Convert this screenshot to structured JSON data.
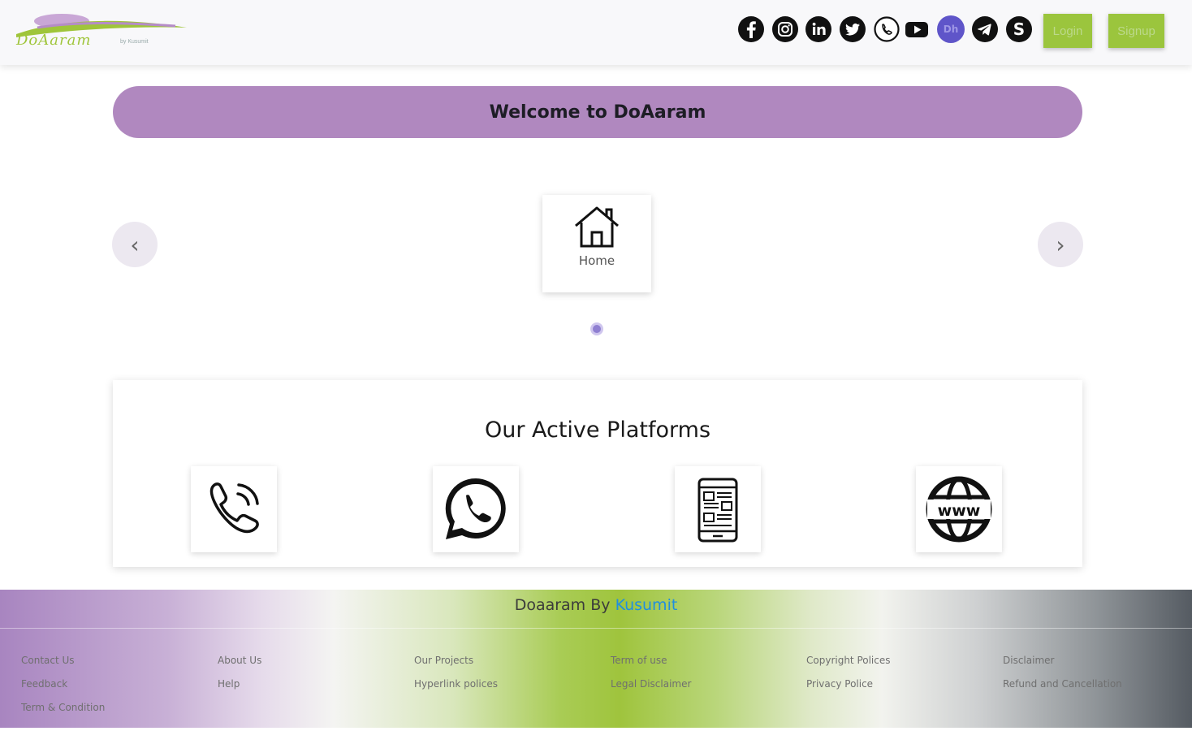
{
  "header": {
    "logo_text": "DoAaram",
    "logo_sub": "by Kusumit",
    "social_icons": [
      "facebook-icon",
      "instagram-icon",
      "linkedin-icon",
      "twitter-icon",
      "whatsapp-icon",
      "youtube-icon",
      "dh-icon",
      "telegram-icon",
      "skype-icon"
    ],
    "dh_badge_text": "Dh",
    "login_label": "Login",
    "signup_label": "Signup"
  },
  "welcome": {
    "text": "Welcome to DoAaram"
  },
  "carousel": {
    "prev_glyph": "‹",
    "next_glyph": "›",
    "slides": [
      {
        "label": "Home",
        "icon": "home-icon"
      }
    ],
    "active_index": 0
  },
  "platforms": {
    "title": "Our Active Platforms",
    "items": [
      {
        "icon": "phone-call-icon"
      },
      {
        "icon": "whatsapp-icon"
      },
      {
        "icon": "mobile-app-icon"
      },
      {
        "icon": "website-www-icon"
      }
    ]
  },
  "footer": {
    "title_prefix": "Doaaram By ",
    "title_brand": "Kusumit",
    "columns": [
      [
        "Contact Us",
        "Feedback",
        "Term & Condition"
      ],
      [
        "About Us",
        "Help"
      ],
      [
        "Our Projects",
        "Hyperlink polices"
      ],
      [
        "Term of use",
        "Legal Disclaimer"
      ],
      [
        "Copyright Polices",
        "Privacy Police"
      ],
      [
        "Disclaimer",
        "Refund and Cancellation"
      ]
    ]
  },
  "colors": {
    "accent_purple": "#b088bf",
    "accent_green": "#9bc53d",
    "link_blue": "#1f8fe0"
  }
}
